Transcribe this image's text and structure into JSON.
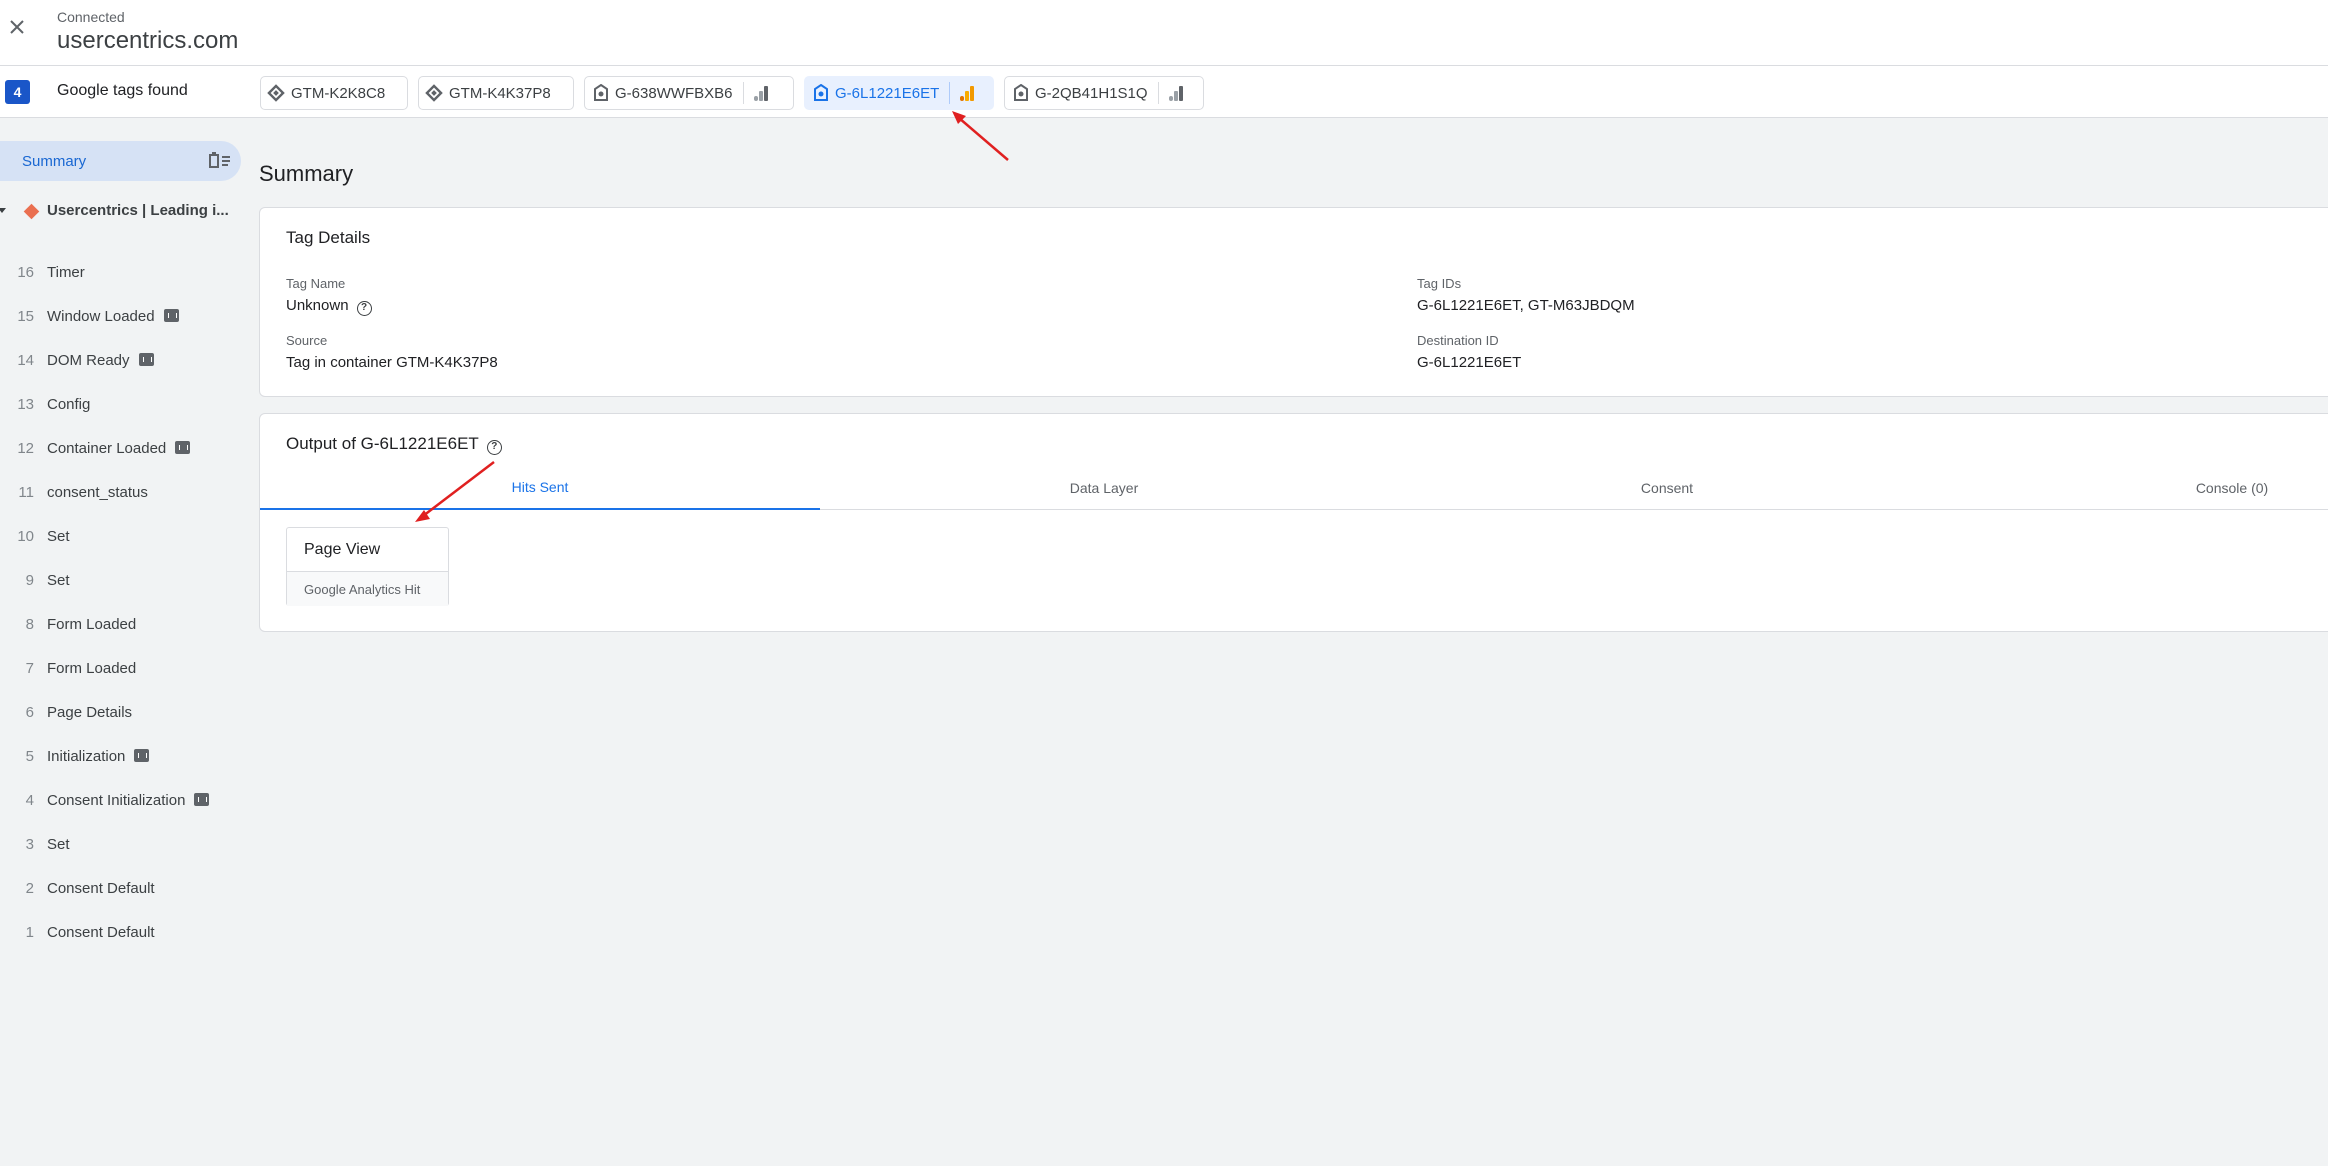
{
  "header": {
    "status": "Connected",
    "site": "usercentrics.com"
  },
  "tagbar": {
    "count": "4",
    "label": "Google tags found",
    "chips": [
      {
        "id": "GTM-K2K8C8",
        "icon": "gtm-diamond-icon"
      },
      {
        "id": "GTM-K4K37P8",
        "icon": "gtm-diamond-icon"
      },
      {
        "id": "G-638WWFBXB6",
        "icon": "google-tag-icon",
        "bars_color": "#5f6368"
      },
      {
        "id": "G-6L1221E6ET",
        "icon": "google-tag-icon",
        "bars_color": "#f29900",
        "active": true
      },
      {
        "id": "G-2QB41H1S1Q",
        "icon": "google-tag-icon",
        "bars_color": "#5f6368"
      }
    ]
  },
  "sidebar": {
    "summary_label": "Summary",
    "page": "Usercentrics | Leading i...",
    "events": [
      {
        "num": "16",
        "name": "Timer",
        "api": false
      },
      {
        "num": "15",
        "name": "Window Loaded",
        "api": true
      },
      {
        "num": "14",
        "name": "DOM Ready",
        "api": true
      },
      {
        "num": "13",
        "name": "Config",
        "api": false
      },
      {
        "num": "12",
        "name": "Container Loaded",
        "api": true
      },
      {
        "num": "11",
        "name": "consent_status",
        "api": false
      },
      {
        "num": "10",
        "name": "Set",
        "api": false
      },
      {
        "num": "9",
        "name": "Set",
        "api": false
      },
      {
        "num": "8",
        "name": "Form Loaded",
        "api": false
      },
      {
        "num": "7",
        "name": "Form Loaded",
        "api": false
      },
      {
        "num": "6",
        "name": "Page Details",
        "api": false
      },
      {
        "num": "5",
        "name": "Initialization",
        "api": true
      },
      {
        "num": "4",
        "name": "Consent Initialization",
        "api": true
      },
      {
        "num": "3",
        "name": "Set",
        "api": false
      },
      {
        "num": "2",
        "name": "Consent Default",
        "api": false
      },
      {
        "num": "1",
        "name": "Consent Default",
        "api": false
      }
    ]
  },
  "main": {
    "title": "Summary",
    "tag_details": {
      "title": "Tag Details",
      "tag_name_label": "Tag Name",
      "tag_name": "Unknown",
      "source_label": "Source",
      "source": "Tag in container GTM-K4K37P8",
      "tag_ids_label": "Tag IDs",
      "tag_ids": "G-6L1221E6ET, GT-M63JBDQM",
      "destination_label": "Destination ID",
      "destination": "G-6L1221E6ET"
    },
    "output": {
      "title": "Output of G-6L1221E6ET",
      "tabs": [
        "Hits Sent",
        "Data Layer",
        "Consent",
        "Console (0)"
      ],
      "hit_title": "Page View",
      "hit_type": "Google Analytics Hit"
    }
  },
  "colors": {
    "accent": "#1a73e8",
    "annotation_arrow": "#e02020"
  }
}
